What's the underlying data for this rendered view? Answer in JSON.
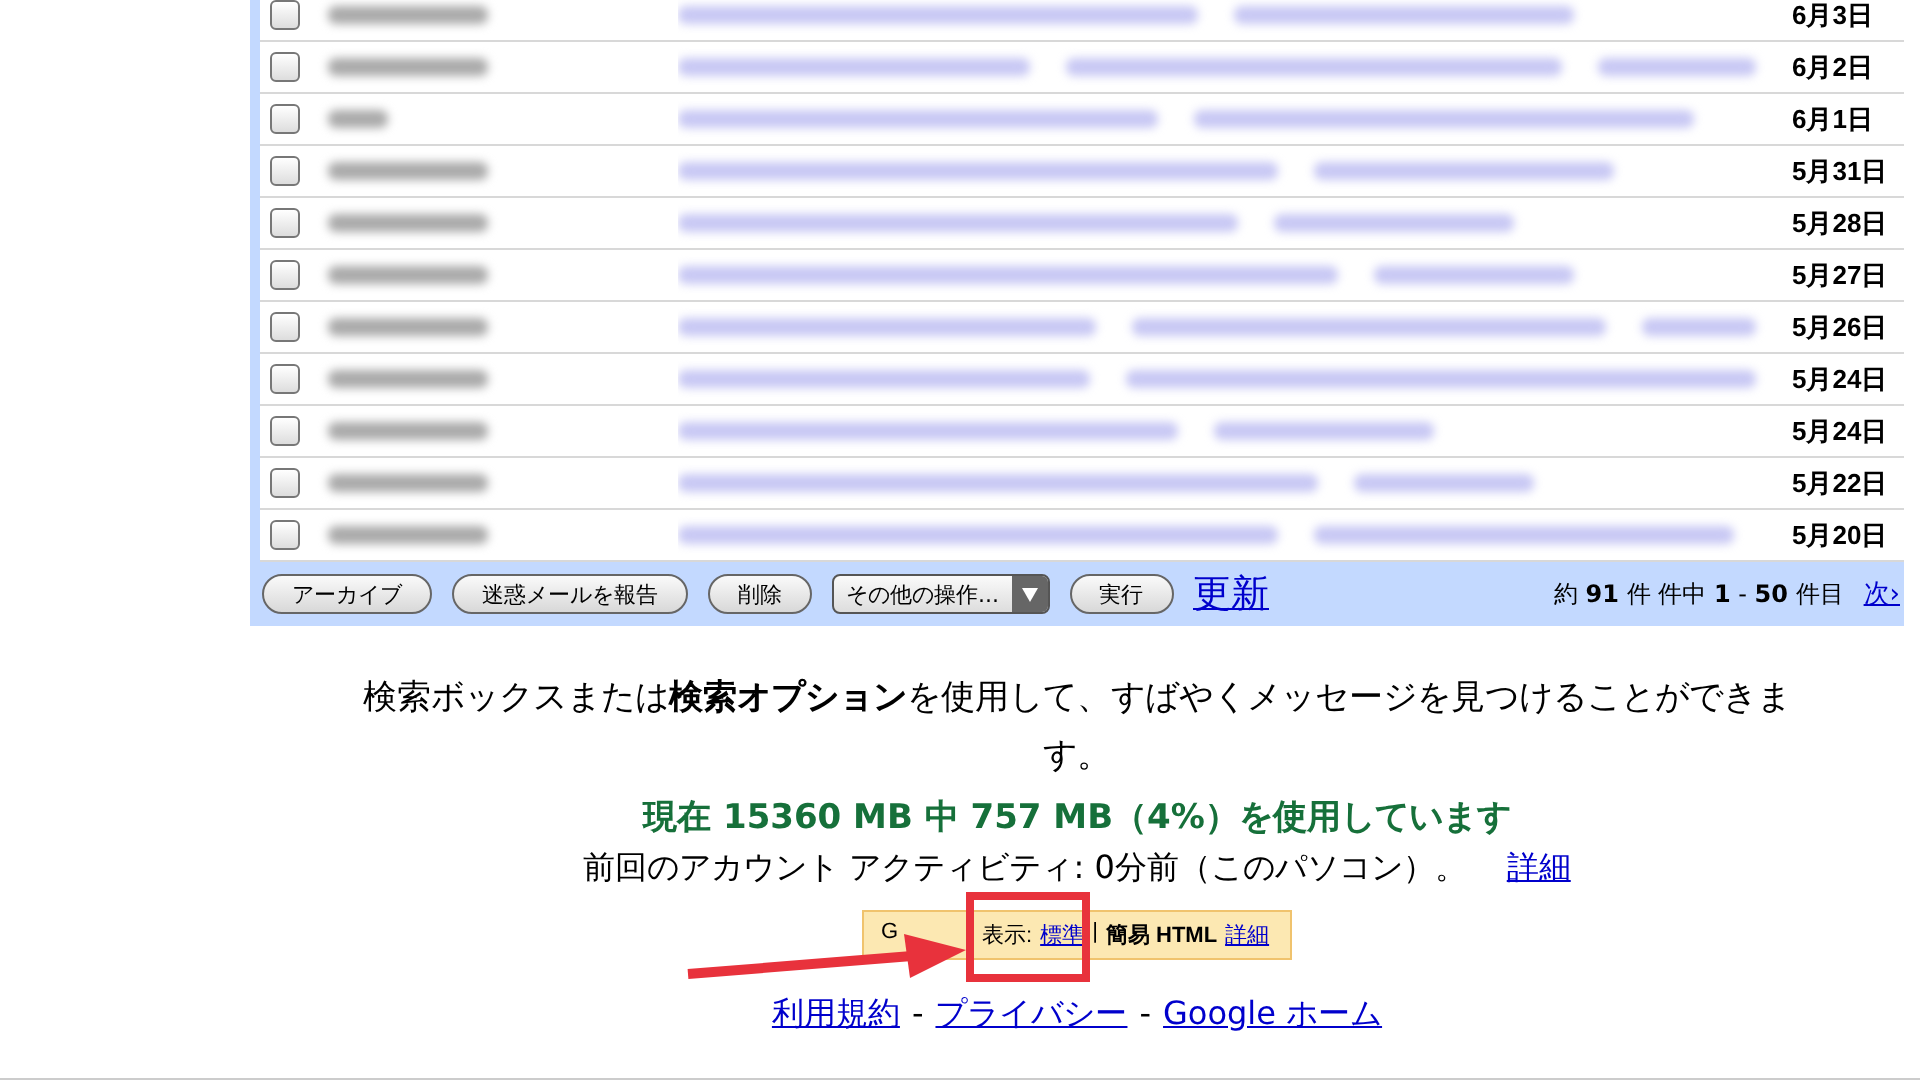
{
  "messages": [
    {
      "checked": false,
      "date": "6月3日"
    },
    {
      "checked": false,
      "date": "6月2日"
    },
    {
      "checked": false,
      "date": "6月1日"
    },
    {
      "checked": false,
      "date": "5月31日"
    },
    {
      "checked": false,
      "date": "5月28日"
    },
    {
      "checked": false,
      "date": "5月27日"
    },
    {
      "checked": false,
      "date": "5月26日"
    },
    {
      "checked": false,
      "date": "5月24日"
    },
    {
      "checked": false,
      "date": "5月24日"
    },
    {
      "checked": false,
      "date": "5月22日"
    },
    {
      "checked": false,
      "date": "5月20日"
    }
  ],
  "toolbar": {
    "buttons": [
      "アーカイブ",
      "迷惑メールを報告",
      "削除"
    ],
    "dropdown": "その他の操作...",
    "go_button": "実行",
    "refresh_link": "更新",
    "count": "約 **91** 件 件中 **1** - **50** 件目",
    "next_link": "次›"
  },
  "search_tip": "検索ボックスまたは**検索オプション**を使用して、すばやくメッセージを見つけることができます。",
  "storage": "現在 15360 MB 中 757 MB（4%）を使用しています",
  "activity": {
    "text": "前回のアカウント アクティビティ: 0分前（このパソコン）。",
    "link": "詳細"
  },
  "view_switch": {
    "label_start": "G",
    "label_end": "表示:",
    "separator": "|",
    "options": [
      {
        "label": "標準",
        "selected": false
      },
      {
        "label": "簡易 HTML",
        "selected": true
      }
    ],
    "link": "詳細"
  },
  "footer": {
    "links": [
      "利用規約",
      "プライバシー",
      "Google ホーム"
    ],
    "separator": "-"
  }
}
